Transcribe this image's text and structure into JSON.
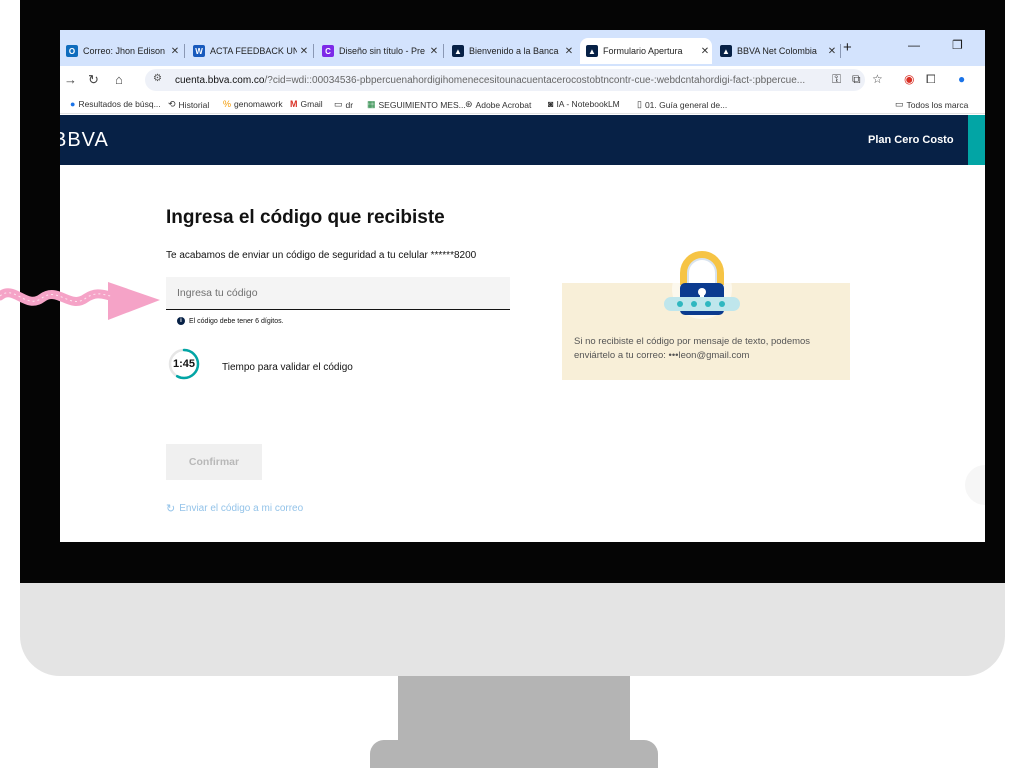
{
  "browser": {
    "tabs": [
      {
        "label": "Correo: Jhon Edison C",
        "icon": "outlook-icon",
        "color": "#0f6cbd"
      },
      {
        "label": "ACTA FEEDBACK UNC",
        "icon": "word-icon",
        "color": "#185abd"
      },
      {
        "label": "Diseño sin título - Pre",
        "icon": "canva-icon",
        "color": "#7d2ae8"
      },
      {
        "label": "Bienvenido a la Banca",
        "icon": "bbva-icon",
        "color": "#072146"
      },
      {
        "label": "Formulario Apertura",
        "icon": "bbva-icon",
        "color": "#072146"
      },
      {
        "label": "BBVA Net Colombia",
        "icon": "bbva-icon",
        "color": "#072146"
      }
    ],
    "url_host": "cuenta.bbva.com.co",
    "url_path": "/?cid=wdi::00034536-pbpercuenahordigihomenecesitounacuentacerocostobtncontr-cue-:webdcntahordigi-fact-:pbpercue...",
    "bookmarks": [
      {
        "label": "Resultados de búsq...",
        "icon": "bookmark-icon"
      },
      {
        "label": "Historial",
        "icon": "history-icon"
      },
      {
        "label": "genomawork",
        "icon": "genomawork-icon"
      },
      {
        "label": "Gmail",
        "icon": "gmail-icon"
      },
      {
        "label": "dr",
        "icon": "folder-icon"
      },
      {
        "label": "SEGUIMIENTO MES...",
        "icon": "sheets-icon"
      },
      {
        "label": "Adobe Acrobat",
        "icon": "acrobat-icon"
      },
      {
        "label": "IA - NotebookLM",
        "icon": "notebooklm-icon"
      },
      {
        "label": "01. Guía general de...",
        "icon": "notion-icon"
      }
    ],
    "all_bookmarks_label": "Todos los marca"
  },
  "header": {
    "logo": "BBVA",
    "plan": "Plan Cero Costo"
  },
  "main": {
    "title": "Ingresa el código que recibiste",
    "subtitle": "Te acabamos de enviar un código de seguridad a tu celular ******8200",
    "code_placeholder": "Ingresa tu código",
    "hint": "El código debe tener 6 dígitos.",
    "timer": "1:45",
    "timer_progress": 0.58,
    "timer_label": "Tiempo para validar el código",
    "confirm_label": "Confirmar",
    "resend_label": "Enviar el código a mi correo"
  },
  "info": {
    "text": "Si no recibiste el código por mensaje de texto, podemos enviártelo a tu correo: •••leon@gmail.com"
  },
  "colors": {
    "brand_navy": "#072146",
    "accent_teal": "#02a5a5",
    "info_bg": "#f8efd8",
    "link_blue": "#93c3e9",
    "annotation_pink": "#f5a3c7"
  }
}
